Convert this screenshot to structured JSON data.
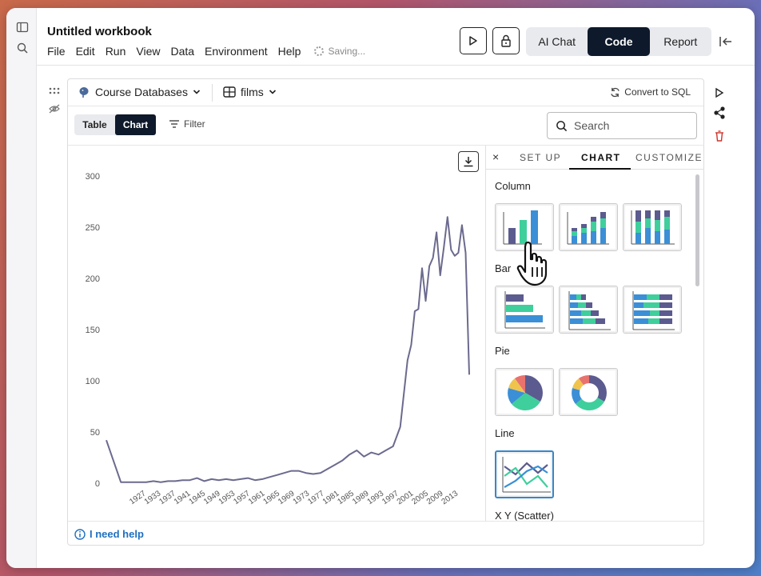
{
  "app": {
    "title": "Untitled workbook",
    "menu": [
      "File",
      "Edit",
      "Run",
      "View",
      "Data",
      "Environment",
      "Help"
    ],
    "saving": "Saving...",
    "views": [
      {
        "label": "AI Chat",
        "active": false
      },
      {
        "label": "Code",
        "active": true
      },
      {
        "label": "Report",
        "active": false
      }
    ]
  },
  "cell": {
    "database": "Course Databases",
    "table": "films",
    "convert": "Convert to SQL",
    "toggle": [
      {
        "label": "Table",
        "active": false
      },
      {
        "label": "Chart",
        "active": true
      }
    ],
    "filter": "Filter",
    "search_placeholder": "Search",
    "help": "I need help"
  },
  "panel": {
    "close": "×",
    "tabs": [
      {
        "label": "SET UP",
        "active": false
      },
      {
        "label": "CHART",
        "active": true
      },
      {
        "label": "CUSTOMIZE",
        "active": false
      }
    ],
    "sections": {
      "column": "Column",
      "bar": "Bar",
      "pie": "Pie",
      "line": "Line",
      "scatter": "X Y (Scatter)"
    }
  },
  "colors": {
    "line": "#6b6a8e",
    "accent": "#0e1a2b",
    "navy": "#5b5b8f",
    "teal": "#3fcf9c",
    "blue": "#3b8fd6",
    "delete": "#d0342c"
  },
  "chart_data": {
    "type": "line",
    "title": "",
    "xlabel": "",
    "ylabel": "",
    "ylim": [
      0,
      300
    ],
    "y_ticks": [
      0,
      50,
      100,
      150,
      200,
      250,
      300
    ],
    "x_tick_labels": [
      "1927",
      "1933",
      "1937",
      "1941",
      "1945",
      "1949",
      "1953",
      "1957",
      "1961",
      "1965",
      "1969",
      "1973",
      "1977",
      "1981",
      "1985",
      "1989",
      "1993",
      "1997",
      "2001",
      "2005",
      "2009",
      "2013"
    ],
    "x": [
      1916,
      1920,
      1925,
      1927,
      1929,
      1931,
      1933,
      1935,
      1937,
      1939,
      1941,
      1943,
      1945,
      1947,
      1949,
      1951,
      1953,
      1955,
      1957,
      1959,
      1961,
      1963,
      1965,
      1967,
      1969,
      1971,
      1973,
      1975,
      1977,
      1979,
      1981,
      1983,
      1985,
      1987,
      1989,
      1991,
      1993,
      1995,
      1997,
      1999,
      2000,
      2001,
      2002,
      2003,
      2004,
      2005,
      2006,
      2007,
      2008,
      2009,
      2010,
      2011,
      2012,
      2013,
      2014,
      2015,
      2016
    ],
    "y": [
      42,
      1,
      1,
      1,
      2,
      1,
      2,
      2,
      3,
      3,
      5,
      2,
      4,
      3,
      4,
      3,
      4,
      5,
      3,
      4,
      6,
      8,
      10,
      12,
      12,
      10,
      9,
      10,
      14,
      18,
      22,
      28,
      32,
      26,
      30,
      28,
      32,
      36,
      55,
      120,
      135,
      168,
      170,
      210,
      178,
      212,
      220,
      245,
      203,
      230,
      260,
      228,
      222,
      225,
      252,
      225,
      106
    ],
    "grid": false,
    "legend": "none"
  }
}
